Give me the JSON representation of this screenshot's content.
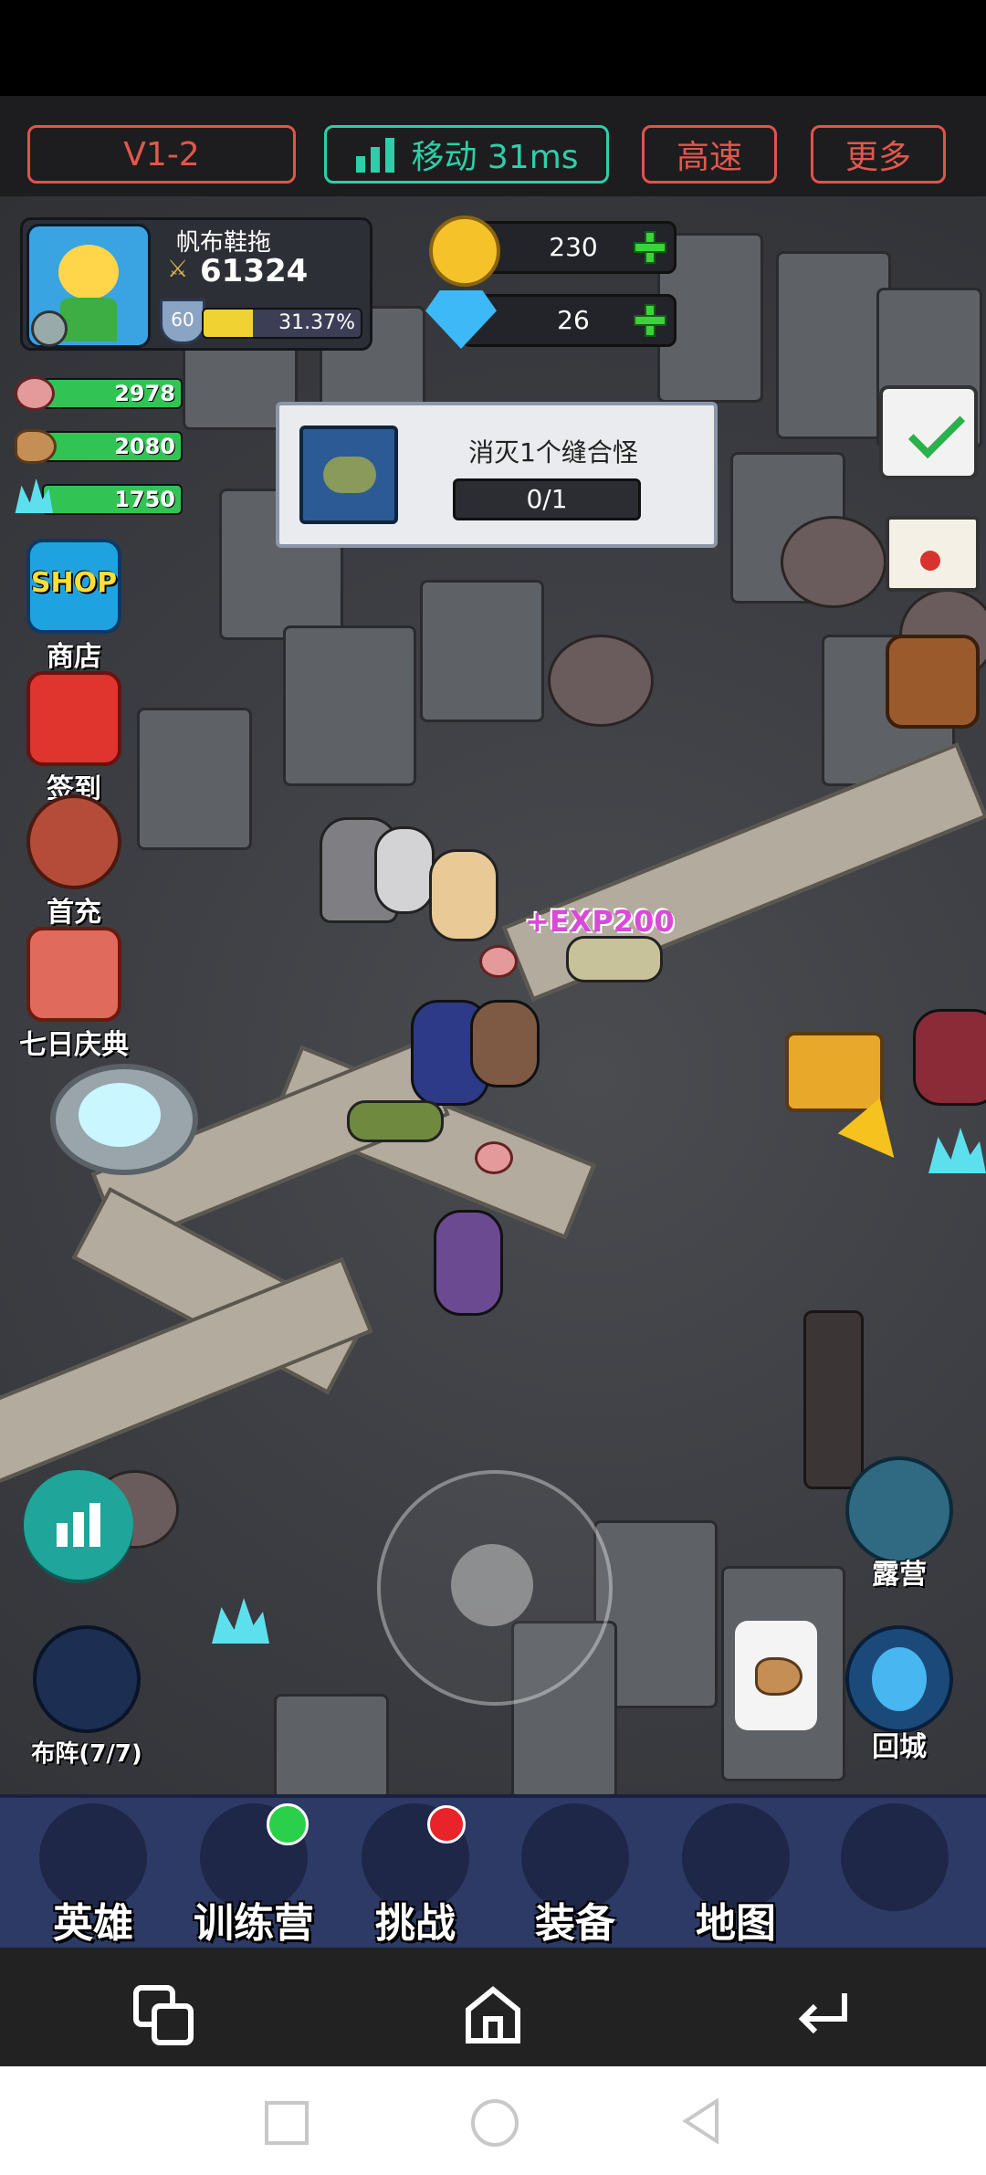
{
  "topbar": {
    "version": "V1-2",
    "network": "移动 31ms",
    "speed": "高速",
    "more": "更多"
  },
  "player": {
    "name": "帆布鞋拖",
    "power": "61324",
    "level": "60",
    "exp_percent": "31.37%",
    "exp_fraction": 0.3137
  },
  "currency": {
    "gold": "230",
    "diamond": "26"
  },
  "resources": {
    "meat": "2978",
    "wood": "2080",
    "crystal": "1750"
  },
  "left_menu": {
    "shop_badge": "SHOP",
    "shop": "商店",
    "signin": "签到",
    "first_charge": "首充",
    "seven_day": "七日庆典"
  },
  "quest": {
    "title": "消灭1个缝合怪",
    "progress": "0/1"
  },
  "floating": {
    "exp": "+EXP200"
  },
  "right_menu": {
    "camp": "露营",
    "return_city": "回城"
  },
  "formation": {
    "label": "布阵(7/7)"
  },
  "bottom_nav": {
    "heroes": "英雄",
    "training": "训练营",
    "challenge": "挑战",
    "equipment": "装备",
    "map": "地图"
  },
  "colors": {
    "accent_red": "#e2574c",
    "accent_green": "#2ecfa8",
    "bar_green": "#31c455",
    "nav_bg": "#2e3a66"
  }
}
